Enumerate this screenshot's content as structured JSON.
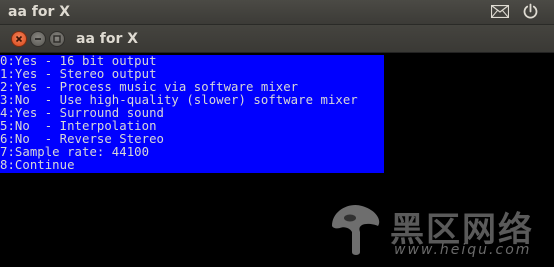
{
  "top_panel": {
    "title": "aa for X",
    "icons": [
      "mail-icon",
      "power-icon"
    ]
  },
  "window": {
    "title": "aa for X",
    "buttons": [
      "close-icon",
      "minimize-icon",
      "maximize-icon"
    ]
  },
  "menu": {
    "background_color": "#0000ff",
    "text_color": "#d8d8d8",
    "lines": [
      "0:Yes - 16 bit output",
      "1:Yes - Stereo output",
      "2:Yes - Process music via software mixer",
      "3:No  - Use high-quality (slower) software mixer",
      "4:Yes - Surround sound",
      "5:No  - Interpolation",
      "6:No  - Reverse Stereo",
      "7:Sample rate: 44100",
      "8:Continue"
    ]
  },
  "watermark": {
    "text_cn": "黑区网络",
    "url": "www.heiqu.com"
  }
}
